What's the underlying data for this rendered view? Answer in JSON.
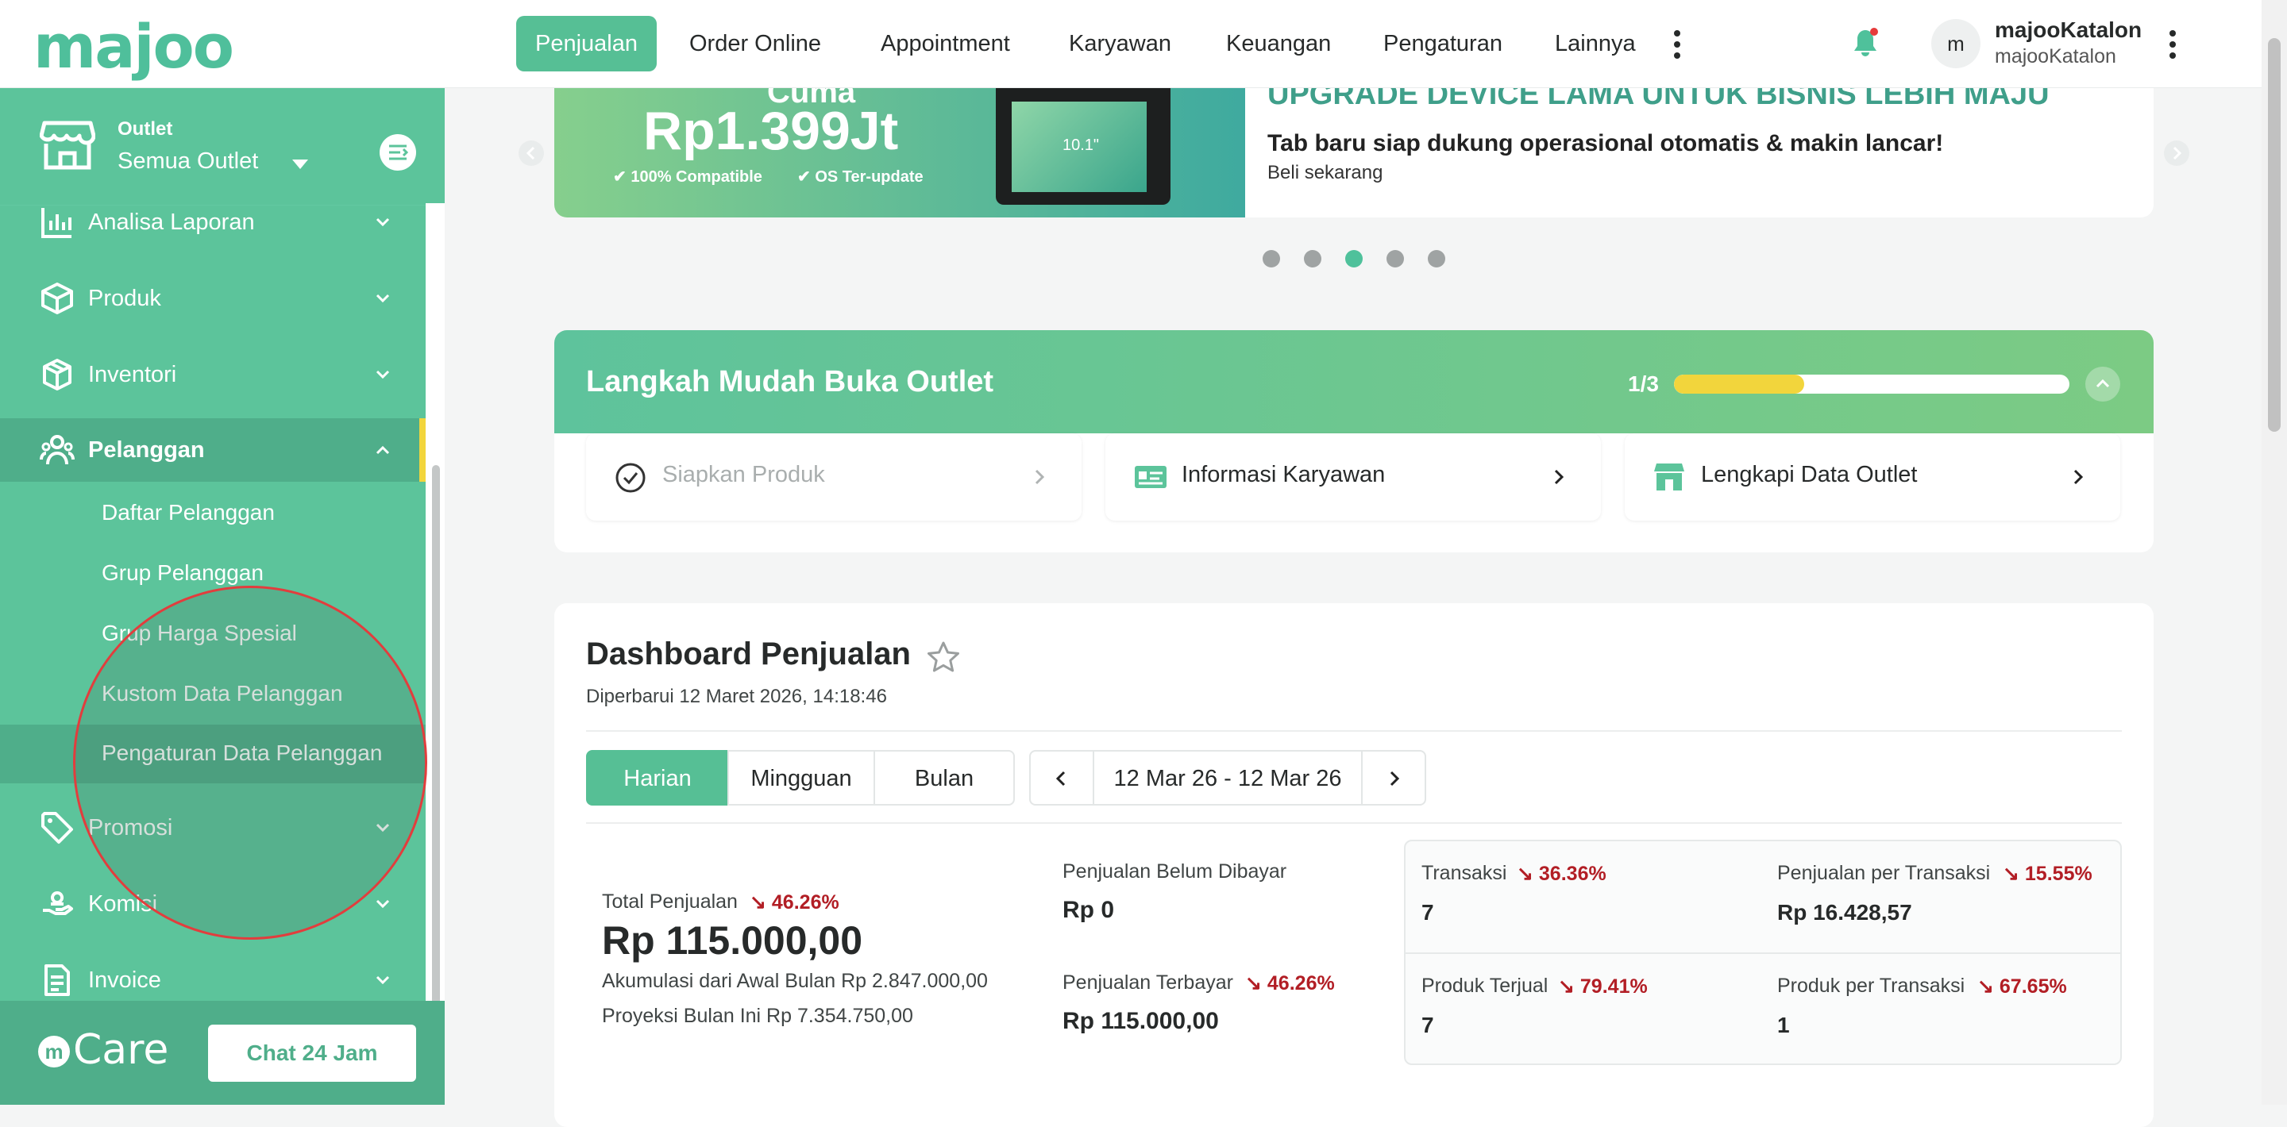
{
  "brand": {
    "logo_text": "majoo"
  },
  "topnav": {
    "tabs": [
      {
        "label": "Penjualan"
      },
      {
        "label": "Order Online"
      },
      {
        "label": "Appointment"
      },
      {
        "label": "Karyawan"
      },
      {
        "label": "Keuangan"
      },
      {
        "label": "Pengaturan"
      },
      {
        "label": "Lainnya"
      }
    ],
    "user": {
      "avatar_initial": "m",
      "name": "majooKatalon",
      "subtitle": "majooKatalon"
    }
  },
  "sidebar": {
    "outlet_label": "Outlet",
    "outlet_value": "Semua Outlet",
    "items": [
      {
        "label": "Analisa Laporan",
        "icon": "chart-icon"
      },
      {
        "label": "Produk",
        "icon": "box-icon"
      },
      {
        "label": "Inventori",
        "icon": "inventory-icon"
      },
      {
        "label": "Pelanggan",
        "icon": "customers-icon"
      },
      {
        "label": "Promosi",
        "icon": "tag-icon"
      },
      {
        "label": "Komisi",
        "icon": "commission-icon"
      },
      {
        "label": "Invoice",
        "icon": "invoice-icon"
      }
    ],
    "pelanggan_sub": [
      {
        "label": "Daftar Pelanggan"
      },
      {
        "label": "Grup Pelanggan"
      },
      {
        "label": "Grup Harga Spesial"
      },
      {
        "label": "Kustom Data Pelanggan"
      },
      {
        "label": "Pengaturan Data Pelanggan"
      }
    ],
    "care_text": "Care",
    "chat_button": "Chat 24 Jam"
  },
  "banner": {
    "price_prefix": "Cuma",
    "price": "Rp1.399Jt",
    "badge_1": "100% Compatible",
    "badge_2": "OS Ter-update",
    "device_label": "10.1\"",
    "headline": "UPGRADE DEVICE LAMA UNTUK BISNIS LEBIH MAJU",
    "subheadline": "Tab baru siap dukung operasional otomatis & makin lancar!",
    "cta": "Beli sekarang",
    "slides_total": 5,
    "active_slide": 3
  },
  "onboarding": {
    "title": "Langkah Mudah Buka Outlet",
    "progress_text": "1/3",
    "progress_fraction": 0.33,
    "steps": [
      {
        "label": "Siapkan Produk",
        "done": true
      },
      {
        "label": "Informasi Karyawan",
        "done": false
      },
      {
        "label": "Lengkapi Data Outlet",
        "done": false
      }
    ]
  },
  "dashboard": {
    "title": "Dashboard Penjualan",
    "updated": "Diperbarui 12 Maret 2026, 14:18:46",
    "periods": [
      {
        "label": "Harian"
      },
      {
        "label": "Mingguan"
      },
      {
        "label": "Bulan"
      }
    ],
    "date_range": "12 Mar 26 - 12 Mar 26",
    "total": {
      "label": "Total Penjualan",
      "change": "46.26%",
      "value": "Rp 115.000,00",
      "akumulasi": "Akumulasi dari Awal Bulan Rp 2.847.000,00",
      "proyeksi": "Proyeksi Bulan Ini Rp 7.354.750,00"
    },
    "belum_dibayar": {
      "label": "Penjualan Belum Dibayar",
      "value": "Rp 0"
    },
    "terbayar": {
      "label": "Penjualan Terbayar",
      "change": "46.26%",
      "value": "Rp 115.000,00"
    },
    "kpis": [
      {
        "label": "Transaksi",
        "change": "36.36%",
        "value": "7"
      },
      {
        "label": "Penjualan per Transaksi",
        "change": "15.55%",
        "value": "Rp 16.428,57"
      },
      {
        "label": "Produk Terjual",
        "change": "79.41%",
        "value": "7"
      },
      {
        "label": "Produk per Transaksi",
        "change": "67.65%",
        "value": "1"
      }
    ]
  },
  "colors": {
    "brand": "#5cc49b",
    "accent": "#56bf95",
    "down": "#b21e25",
    "progress": "#f2d53c"
  }
}
